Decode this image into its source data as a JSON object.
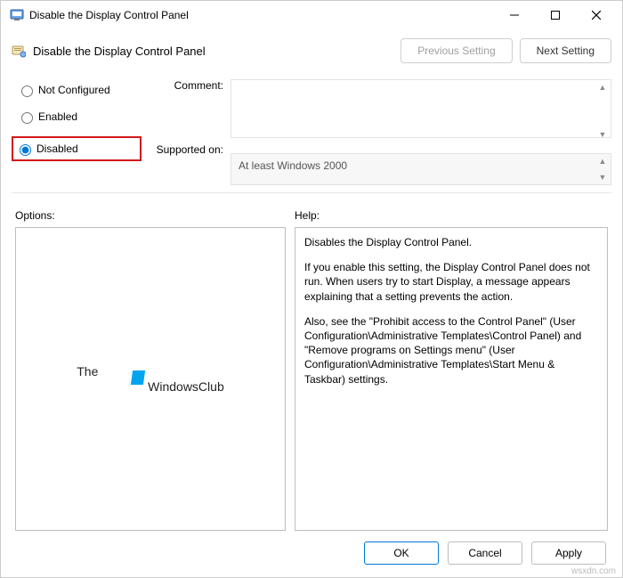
{
  "window": {
    "title": "Disable the Display Control Panel"
  },
  "header": {
    "policyName": "Disable the Display Control Panel",
    "prevSetting": "Previous Setting",
    "nextSetting": "Next Setting"
  },
  "radios": {
    "notConfigured": "Not Configured",
    "enabled": "Enabled",
    "disabled": "Disabled",
    "selected": "disabled"
  },
  "labels": {
    "comment": "Comment:",
    "supportedOn": "Supported on:",
    "options": "Options:",
    "help": "Help:"
  },
  "fields": {
    "commentValue": "",
    "supportedOnValue": "At least Windows 2000"
  },
  "help": {
    "p1": "Disables the Display Control Panel.",
    "p2": "If you enable this setting, the Display Control Panel does not run. When users try to start Display, a message appears explaining that a setting prevents the action.",
    "p3": "Also, see the \"Prohibit access to the Control Panel\" (User Configuration\\Administrative Templates\\Control Panel) and \"Remove programs on Settings menu\" (User Configuration\\Administrative Templates\\Start Menu & Taskbar) settings."
  },
  "watermark": {
    "line1": "The",
    "line2": "WindowsClub"
  },
  "buttons": {
    "ok": "OK",
    "cancel": "Cancel",
    "apply": "Apply"
  },
  "source": "wsxdn.com"
}
